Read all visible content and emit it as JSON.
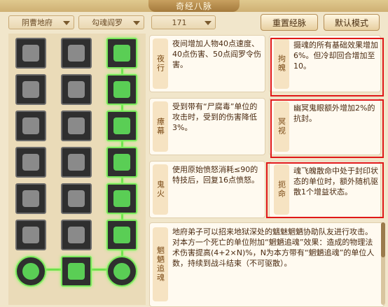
{
  "window": {
    "title": "奇经八脉"
  },
  "filters": {
    "sect": "阴曹地府",
    "skill": "勾魂阎罗",
    "level": "171"
  },
  "buttons": {
    "reset": "重置经脉",
    "default": "默认模式"
  },
  "talents": [
    {
      "tag": "夜行",
      "desc": "夜间增加人物40点速度、40点伤害、50点阎罗令伤害。"
    },
    {
      "tag": "瘴幕",
      "desc": "受到带有“尸腐毒”单位的攻击时，受到的伤害降低3%。"
    },
    {
      "tag": "鬼火",
      "desc": "使用原始愤怒消耗≤90的特技后，回复16点愤怒。"
    }
  ],
  "right_talents": [
    {
      "tag": "拘魄",
      "desc": "摄魂的所有基础效果增加6%。但冷却回合增加至10。"
    },
    {
      "tag": "冥视",
      "desc": "幽冥鬼眼额外增加2%的抗封。"
    },
    {
      "tag": "扼命",
      "desc": "魂飞魄散命中处于封印状态的单位时，额外随机驱散1个增益状态。"
    }
  ],
  "detail": {
    "tag": "魍魉追魂",
    "text": "地府弟子可以招来地狱深处的魑魅魍魉协助队友进行攻击。对本方一个死亡的单位附加“魍魉追魂”效果：造成的物理法术伤害提高(4+2×N)%，N为本方带有“魍魉追魂”的单位人数，持续到战斗结束（不可驱散）。"
  }
}
